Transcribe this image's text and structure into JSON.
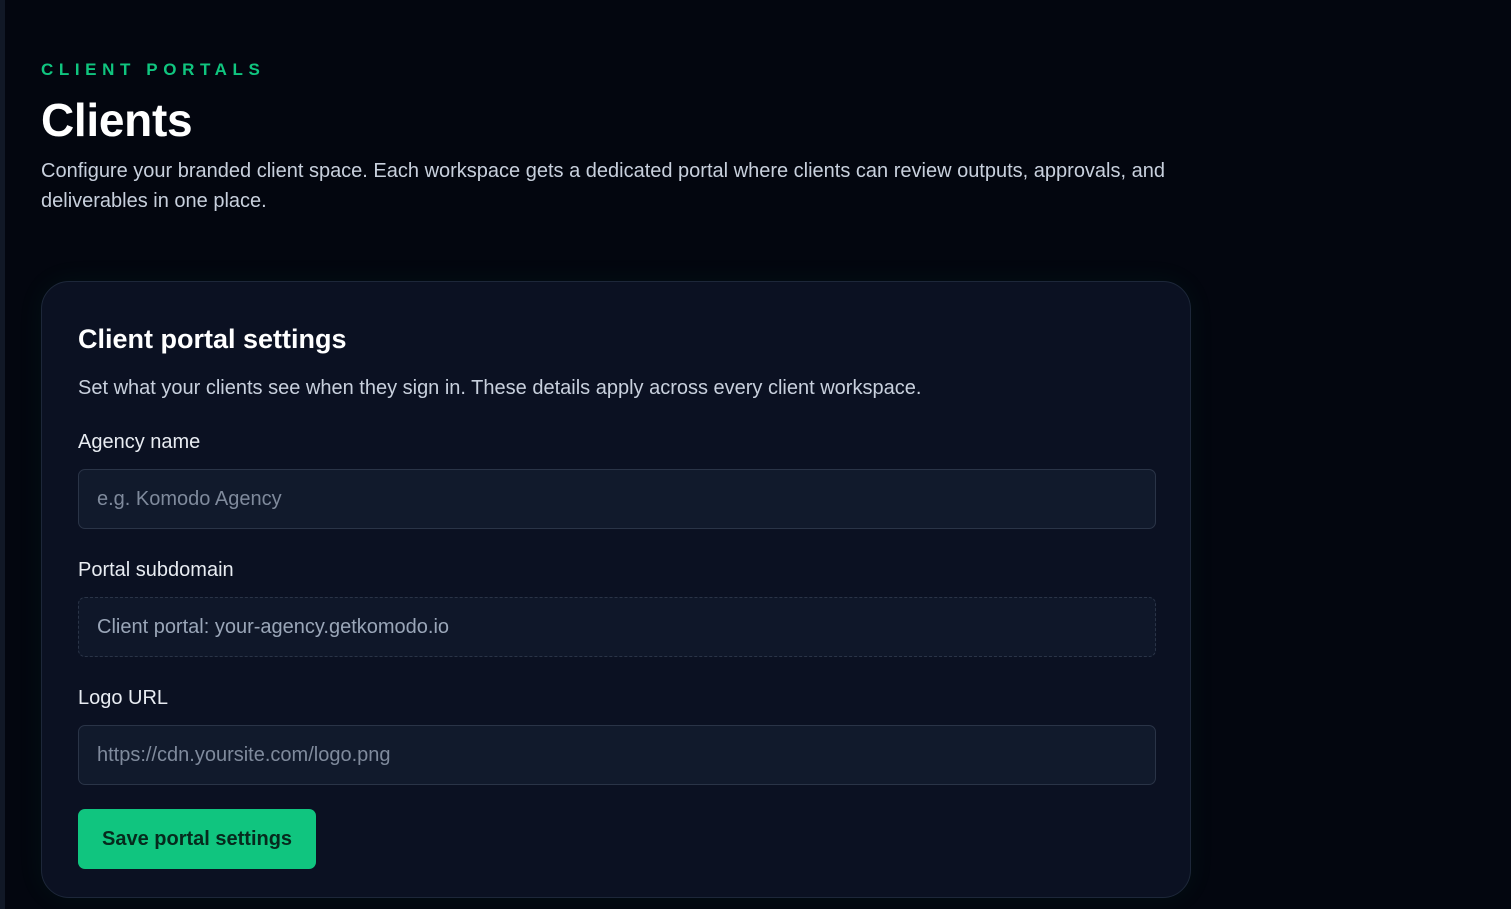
{
  "header": {
    "eyebrow": "CLIENT PORTALS",
    "title": "Clients",
    "subtitle": "Configure your branded client space. Each workspace gets a dedicated portal where clients can review outputs, approvals, and deliverables in one place."
  },
  "card": {
    "title": "Client portal settings",
    "description": "Set what your clients see when they sign in. These details apply across every client workspace.",
    "fields": {
      "agency_name": {
        "label": "Agency name",
        "value": "",
        "placeholder": "e.g. Komodo Agency"
      },
      "portal_subdomain": {
        "label": "Portal subdomain",
        "value": "Client portal: your-agency.getkomodo.io"
      },
      "logo_url": {
        "label": "Logo URL",
        "value": "",
        "placeholder": "https://cdn.yoursite.com/logo.png"
      }
    },
    "save_label": "Save portal settings"
  },
  "colors": {
    "background": "#03060f",
    "card": "#0b1122",
    "accent": "#10c57f",
    "text": "#ffffff",
    "muted": "#c8d0dd"
  }
}
